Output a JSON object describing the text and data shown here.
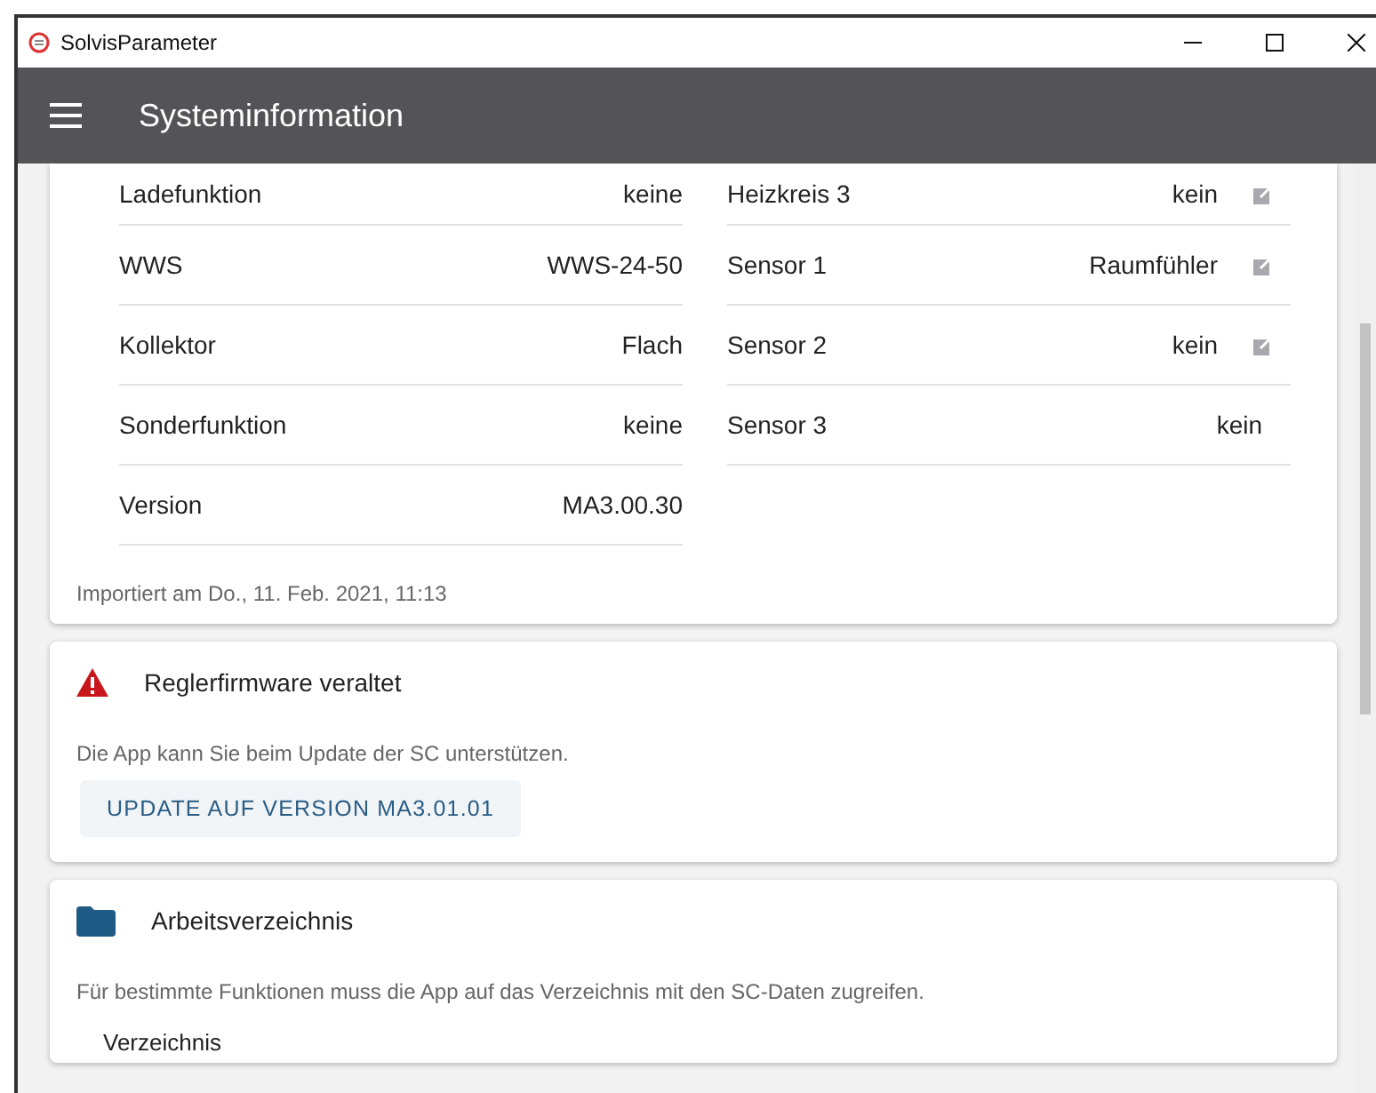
{
  "window": {
    "title": "SolvisParameter"
  },
  "app_bar": {
    "title": "Systeminformation"
  },
  "system_card": {
    "left_rows": [
      {
        "label": "Ladefunktion",
        "value": "keine"
      },
      {
        "label": "WWS",
        "value": "WWS-24-50"
      },
      {
        "label": "Kollektor",
        "value": "Flach"
      },
      {
        "label": "Sonderfunktion",
        "value": "keine"
      },
      {
        "label": "Version",
        "value": "MA3.00.30"
      }
    ],
    "right_rows": [
      {
        "label": "Heizkreis 3",
        "value": "kein",
        "editable": true
      },
      {
        "label": "Sensor 1",
        "value": "Raumfühler",
        "editable": true
      },
      {
        "label": "Sensor 2",
        "value": "kein",
        "editable": true
      },
      {
        "label": "Sensor 3",
        "value": "kein",
        "editable": false
      }
    ],
    "footer": "Importiert am Do., 11. Feb. 2021, 11:13"
  },
  "firmware_card": {
    "title": "Reglerfirmware veraltet",
    "text": "Die App kann Sie beim Update der SC unterstützen.",
    "button": "UPDATE AUF VERSION MA3.01.01"
  },
  "directory_card": {
    "title": "Arbeitsverzeichnis",
    "text": "Für bestimmte Funktionen muss die App auf das Verzeichnis mit den SC-Daten zugreifen.",
    "field_label": "Verzeichnis"
  }
}
